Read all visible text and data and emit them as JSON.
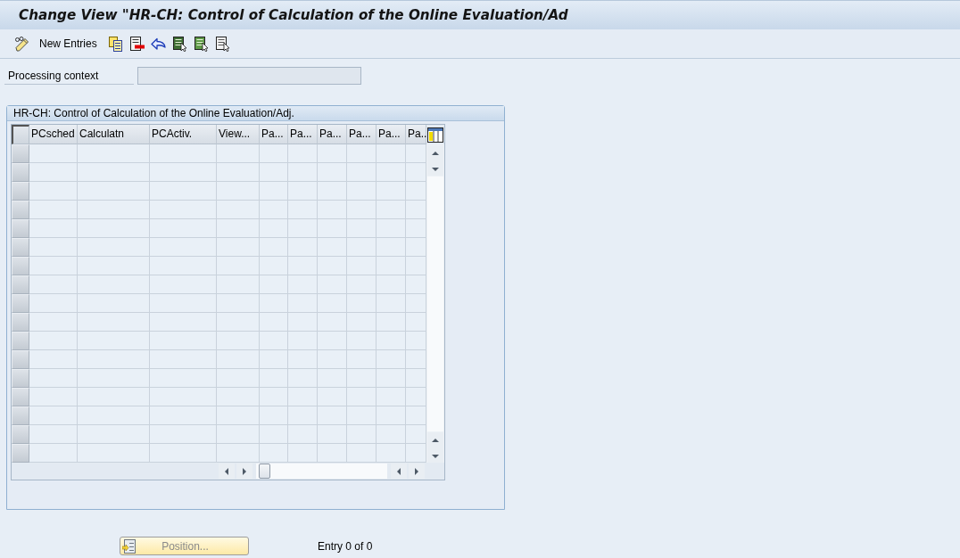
{
  "window": {
    "title": "Change View \"HR-CH: Control of Calculation of the Online Evaluation/Ad"
  },
  "toolbar": {
    "buttons": [
      {
        "kind": "pencil",
        "label": "New Entries"
      },
      {
        "kind": "copy"
      },
      {
        "kind": "delete"
      },
      {
        "kind": "undo"
      },
      {
        "kind": "select-all"
      },
      {
        "kind": "select-block"
      },
      {
        "kind": "deselect"
      }
    ]
  },
  "context_field": {
    "label": "Processing context",
    "disabled": true
  },
  "table": {
    "title": "HR-CH: Control of Calculation of the Online Evaluation/Adj.",
    "columns": [
      "PCsched",
      "Calculatn",
      "PCActiv.",
      "View...",
      "Pa...",
      "Pa...",
      "Pa...",
      "Pa...",
      "Pa...",
      "Pa.."
    ]
  },
  "footer": {
    "position_button": {
      "label": "Position...",
      "disabled": true
    },
    "entry_count": "Entry 0 of 0"
  }
}
